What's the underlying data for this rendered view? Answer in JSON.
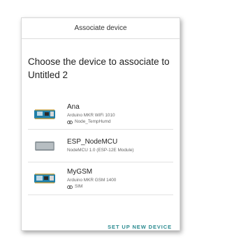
{
  "dialog": {
    "title": "Associate device",
    "prompt": "Choose the device to associate to Untitled 2"
  },
  "devices": [
    {
      "name": "Ana",
      "board": "Arduino MKR WiFi 1010",
      "thing": "Node_TempHumd",
      "icon": "mkr-board-icon"
    },
    {
      "name": "ESP_NodeMCU",
      "board": "NodeMCU 1.0 (ESP-12E Module)",
      "thing": "",
      "icon": "nodemcu-module-icon"
    },
    {
      "name": "MyGSM",
      "board": "Arduino MKR GSM 1400",
      "thing": "SIM",
      "icon": "mkr-board-icon"
    }
  ],
  "actions": {
    "setup_label": "SET UP NEW DEVICE"
  },
  "colors": {
    "accent": "#2a8a90",
    "board_blue": "#1f7fa8"
  }
}
